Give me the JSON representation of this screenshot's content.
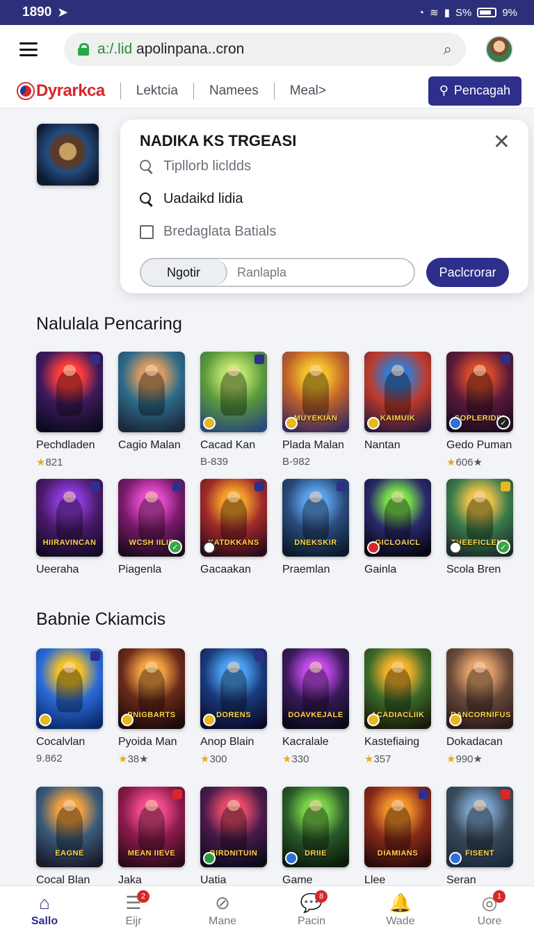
{
  "status_bar": {
    "time": "1890",
    "icons_text": "S%",
    "battery_text": "9%"
  },
  "browser": {
    "url_prefix": "a:/.lid",
    "url_rest": " apolinpana..cron"
  },
  "site_nav": {
    "brand": "Dyrarkca",
    "links": [
      "Lektcia",
      "Namees",
      "Meal>"
    ],
    "cta_label": "Pencagah"
  },
  "search_panel": {
    "title": "NADIKA KS TRGEASI",
    "row1": "Tipllorb licldds",
    "row2": "Uadaikd lidia",
    "row3": "Bredaglata Batials",
    "seg_active": "Ngotir",
    "seg_inactive": "Ranlapla",
    "submit": "Paclcrorar"
  },
  "section1": {
    "title": "Nalulala Pencaring",
    "row1": [
      {
        "name": "Pechdladen",
        "meta": "821",
        "star": true,
        "art": "",
        "colors": [
          "#ff3c3c",
          "#3b1a5c",
          "#0d0a1e"
        ]
      },
      {
        "name": "Cagio Malan",
        "meta": "",
        "star": false,
        "art": "",
        "colors": [
          "#d59b63",
          "#2d6a8a",
          "#1a2a3a"
        ]
      },
      {
        "name": "Cacad Kan",
        "meta": "B-839",
        "star": false,
        "art": "",
        "colors": [
          "#b8e06a",
          "#5a9a3a",
          "#2a4a7a"
        ]
      },
      {
        "name": "Plada Malan",
        "meta": "B-982",
        "star": false,
        "art": "MUYEKIAN",
        "colors": [
          "#f2c02a",
          "#c0622a",
          "#3a2a5a"
        ]
      },
      {
        "name": "Nantan",
        "meta": "",
        "star": false,
        "art": "KAIMUIK",
        "colors": [
          "#3a78c8",
          "#c03a2a",
          "#2a1a3a"
        ]
      },
      {
        "name": "Gedo Puman",
        "meta": "606★",
        "star": true,
        "art": "SOPLERIDIK",
        "colors": [
          "#d24a2a",
          "#5a1a3a",
          "#1a0a1e"
        ]
      }
    ],
    "row2": [
      {
        "name": "Ueeraha",
        "meta": "",
        "art": "HIIRAVINCAN",
        "colors": [
          "#8a3ad8",
          "#4a1a6a",
          "#120a24"
        ]
      },
      {
        "name": "Piagenla",
        "meta": "",
        "art": "WCSH IILIE",
        "colors": [
          "#e04ac8",
          "#7a1a6a",
          "#1a0a1e"
        ]
      },
      {
        "name": "Gacaakan",
        "meta": "",
        "art": "KATDKKANS",
        "colors": [
          "#f2a02a",
          "#a02a2a",
          "#2a0a1a"
        ]
      },
      {
        "name": "Praemlan",
        "meta": "",
        "art": "DNEKSKIR",
        "colors": [
          "#5aa0e8",
          "#2a4a7a",
          "#0a1a2a"
        ]
      },
      {
        "name": "Gainla",
        "meta": "",
        "art": "GICLOAICL",
        "colors": [
          "#7adf4a",
          "#2a2a6a",
          "#050510"
        ]
      },
      {
        "name": "Scola Bren",
        "meta": "",
        "art": "THEEFICLENK",
        "colors": [
          "#e8c04a",
          "#3a7a4a",
          "#1a2a2a"
        ]
      }
    ]
  },
  "section2": {
    "title": "Babnie Ckiamcis",
    "row1": [
      {
        "name": "Cocalvlan",
        "meta": "9.862",
        "star": false,
        "art": "",
        "colors": [
          "#f2c02a",
          "#2a6ad8",
          "#0a2a6a"
        ]
      },
      {
        "name": "Pyoida Man",
        "meta": "38★",
        "star": true,
        "art": "PNIGBARTS",
        "colors": [
          "#f0a040",
          "#6a2a1a",
          "#1a0a0a"
        ]
      },
      {
        "name": "Anop Blain",
        "meta": "300",
        "star": true,
        "art": "DORENS",
        "colors": [
          "#4aa0f0",
          "#1a3a7a",
          "#0a0a2a"
        ]
      },
      {
        "name": "Kacralale",
        "meta": "330",
        "star": true,
        "art": "DOAVKEJALE",
        "colors": [
          "#c04ae8",
          "#3a1a5a",
          "#0a0a1a"
        ]
      },
      {
        "name": "Kastefiaing",
        "meta": "357",
        "star": true,
        "art": "ACADIACLIIK",
        "colors": [
          "#f2b02a",
          "#3a6a2a",
          "#1a1a0a"
        ]
      },
      {
        "name": "Dokadacan",
        "meta": "990★",
        "star": true,
        "art": "RANCORNIFUS",
        "colors": [
          "#e0a06a",
          "#6a4a3a",
          "#2a1a1a"
        ]
      }
    ],
    "row2": [
      {
        "name": "Cocal Blan",
        "art": "EAGNE",
        "colors": [
          "#f0a040",
          "#3a5a7a",
          "#1a1a2a"
        ]
      },
      {
        "name": "Jaka",
        "art": "MEAN IIEVE",
        "colors": [
          "#f04a8a",
          "#8a1a4a",
          "#2a0a1a"
        ]
      },
      {
        "name": "Uatia",
        "art": "BIRDNITUIN",
        "colors": [
          "#e04a6a",
          "#4a1a4a",
          "#0a0a1a"
        ]
      },
      {
        "name": "Game",
        "art": "DRIIE",
        "colors": [
          "#7ad04a",
          "#2a5a2a",
          "#0a1a0a"
        ]
      },
      {
        "name": "Llee",
        "art": "DIAMIANS",
        "colors": [
          "#f0902a",
          "#8a2a1a",
          "#2a0a0a"
        ]
      },
      {
        "name": "Seran",
        "art": "FISENT",
        "colors": [
          "#7aa0c8",
          "#3a4a5a",
          "#1a2a3a"
        ]
      }
    ]
  },
  "bottom_nav": [
    {
      "label": "Sallo",
      "icon": "home-icon",
      "badge": ""
    },
    {
      "label": "Eijr",
      "icon": "list-icon",
      "badge": "2"
    },
    {
      "label": "Mane",
      "icon": "slash-circle-icon",
      "badge": ""
    },
    {
      "label": "Pacin",
      "icon": "chat-icon",
      "badge": "8"
    },
    {
      "label": "Wade",
      "icon": "bell-icon",
      "badge": ""
    },
    {
      "label": "Uore",
      "icon": "profile-icon",
      "badge": "1"
    }
  ]
}
